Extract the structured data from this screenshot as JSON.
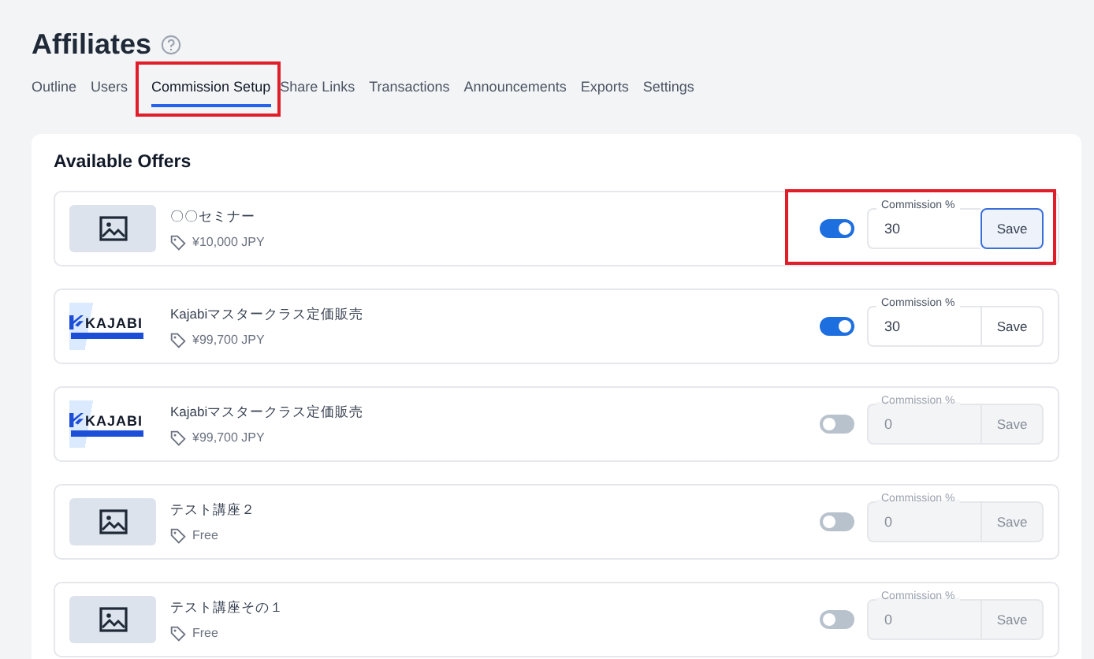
{
  "page": {
    "title": "Affiliates"
  },
  "tabs": [
    {
      "label": "Outline",
      "selected": false,
      "highlighted": false
    },
    {
      "label": "Users",
      "selected": false,
      "highlighted": false
    },
    {
      "label": "Commission Setup",
      "selected": true,
      "highlighted": true
    },
    {
      "label": "Share Links",
      "selected": false,
      "highlighted": false
    },
    {
      "label": "Transactions",
      "selected": false,
      "highlighted": false
    },
    {
      "label": "Announcements",
      "selected": false,
      "highlighted": false
    },
    {
      "label": "Exports",
      "selected": false,
      "highlighted": false
    },
    {
      "label": "Settings",
      "selected": false,
      "highlighted": false
    }
  ],
  "offers_panel": {
    "title": "Available Offers",
    "offers": [
      {
        "image": {
          "kind": "placeholder"
        },
        "name": "〇〇セミナー",
        "price": "¥10,000 JPY",
        "on": true,
        "commission_label": "Commission %",
        "commission": "30",
        "save": "Save",
        "save_focused": true,
        "highlighted": true
      },
      {
        "image": {
          "kind": "logo",
          "text": "KAJABI"
        },
        "name": "Kajabiマスタークラス定価販売",
        "price": "¥99,700 JPY",
        "on": true,
        "commission_label": "Commission %",
        "commission": "30",
        "save": "Save",
        "save_focused": false,
        "highlighted": false
      },
      {
        "image": {
          "kind": "logo",
          "text": "KAJABI"
        },
        "name": "Kajabiマスタークラス定価販売",
        "price": "¥99,700 JPY",
        "on": false,
        "commission_label": "Commission %",
        "commission": "0",
        "save": "Save",
        "save_focused": false,
        "highlighted": false
      },
      {
        "image": {
          "kind": "placeholder"
        },
        "name": "テスト講座２",
        "price": "Free",
        "on": false,
        "commission_label": "Commission %",
        "commission": "0",
        "save": "Save",
        "save_focused": false,
        "highlighted": false
      },
      {
        "image": {
          "kind": "placeholder"
        },
        "name": "テスト講座その１",
        "price": "Free",
        "on": false,
        "commission_label": "Commission %",
        "commission": "0",
        "save": "Save",
        "save_focused": false,
        "highlighted": false
      }
    ]
  }
}
